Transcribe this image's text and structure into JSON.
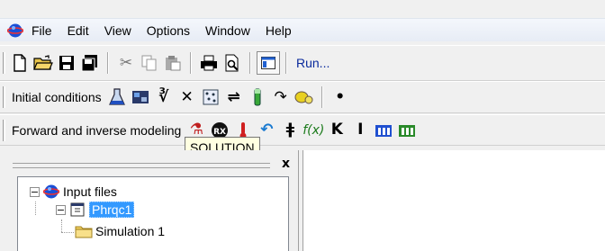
{
  "menubar": {
    "app_icon": "phreeqc-globe-icon",
    "items": [
      "File",
      "Edit",
      "View",
      "Options",
      "Window",
      "Help"
    ]
  },
  "toolbar_main": {
    "buttons": [
      "new-document-icon",
      "open-folder-icon",
      "save-icon",
      "save-all-icon",
      "cut-icon",
      "copy-icon",
      "paste-icon",
      "print-icon",
      "print-preview-icon",
      "tree-view-toggle-icon"
    ],
    "run_label": "Run..."
  },
  "toolbar_initial": {
    "label": "Initial conditions",
    "buttons": [
      "solution-flask-icon",
      "equilibrium-phases-icon",
      "exchange-icon",
      "surface-icon",
      "gas-phase-icon",
      "solid-solutions-icon",
      "kinetics-icon",
      "reaction-icon",
      "mix-icon",
      "dot-icon"
    ]
  },
  "toolbar_forward": {
    "label": "Forward and inverse modeling",
    "buttons": [
      "solution-spread-icon",
      "rx-icon",
      "temperature-icon",
      "undo-reaction-icon",
      "transport-icon",
      "fx-icon",
      "k-icon",
      "i-icon",
      "advection-icon",
      "inverse-icon"
    ]
  },
  "tooltip": {
    "text": "SOLUTION"
  },
  "panel": {
    "close_label": "x"
  },
  "tree": {
    "root": {
      "label": "Input files",
      "expander": "−"
    },
    "child": {
      "label": "Phrqc1",
      "expander": "−"
    },
    "leaf": {
      "label": "Simulation 1"
    }
  },
  "colors": {
    "selection": "#3399ff",
    "tooltip_bg": "#ffffe1",
    "run_link": "#0a2a9c"
  }
}
